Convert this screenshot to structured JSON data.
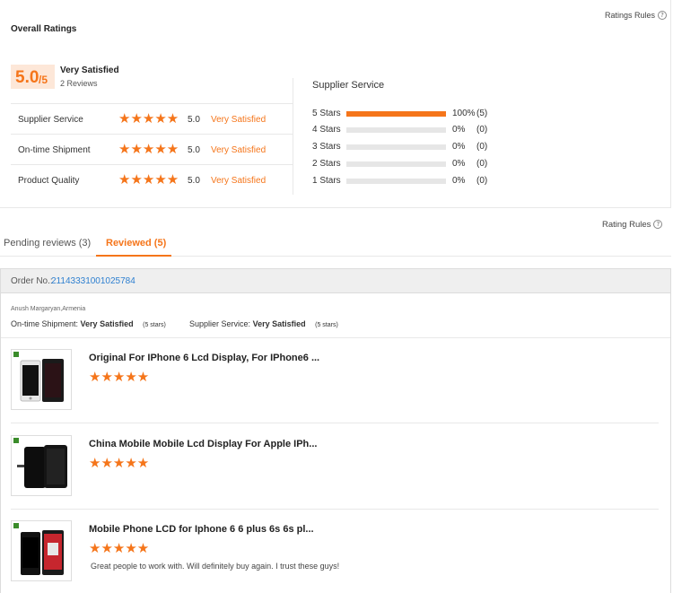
{
  "overall": {
    "title": "Overall Ratings",
    "rules_link": "Ratings Rules",
    "score_main": "5.0",
    "score_suffix": "/5",
    "label": "Very Satisfied",
    "reviews": "2 Reviews"
  },
  "categories": [
    {
      "label": "Supplier Service",
      "stars": "★★★★★",
      "score": "5.0",
      "desc": "Very Satisfied"
    },
    {
      "label": "On-time Shipment",
      "stars": "★★★★★",
      "score": "5.0",
      "desc": "Very Satisfied"
    },
    {
      "label": "Product Quality",
      "stars": "★★★★★",
      "score": "5.0",
      "desc": "Very Satisfied"
    }
  ],
  "breakdown": {
    "title": "Supplier Service",
    "rows": [
      {
        "label": "5 Stars",
        "fill": 1.0,
        "pct": "100%",
        "count": "(5)"
      },
      {
        "label": "4 Stars",
        "fill": 0.0,
        "pct": "0%",
        "count": "(0)"
      },
      {
        "label": "3 Stars",
        "fill": 0.0,
        "pct": "0%",
        "count": "(0)"
      },
      {
        "label": "2 Stars",
        "fill": 0.0,
        "pct": "0%",
        "count": "(0)"
      },
      {
        "label": "1 Stars",
        "fill": 0.0,
        "pct": "0%",
        "count": "(0)"
      }
    ]
  },
  "rating_rules": "Rating Rules",
  "tabs": {
    "pending": "Pending reviews (3)",
    "reviewed": "Reviewed (5)"
  },
  "order": {
    "label": "Order No.:",
    "number": "21143331001025784",
    "buyer": "Anush Margaryan,Armenia",
    "ontime_label": "On-time Shipment:",
    "ontime_value": "Very Satisfied",
    "ontime_stars": "(5 stars)",
    "service_label": "Supplier Service:",
    "service_value": "Very Satisfied",
    "service_stars": "(5 stars)"
  },
  "products": [
    {
      "title": "Original For IPhone 6 Lcd Display, For IPhone6 ...",
      "stars": "★★★★★",
      "comment": ""
    },
    {
      "title": "China Mobile Mobile Lcd Display For Apple IPh...",
      "stars": "★★★★★",
      "comment": ""
    },
    {
      "title": "Mobile Phone LCD for Iphone 6 6 plus 6s 6s pl...",
      "stars": "★★★★★",
      "comment": "Great people to work with. Will definitely buy again. I trust these guys!"
    }
  ],
  "colors": {
    "accent": "#f5751a",
    "link": "#2d7fd0"
  },
  "icons": {
    "help": "?"
  }
}
